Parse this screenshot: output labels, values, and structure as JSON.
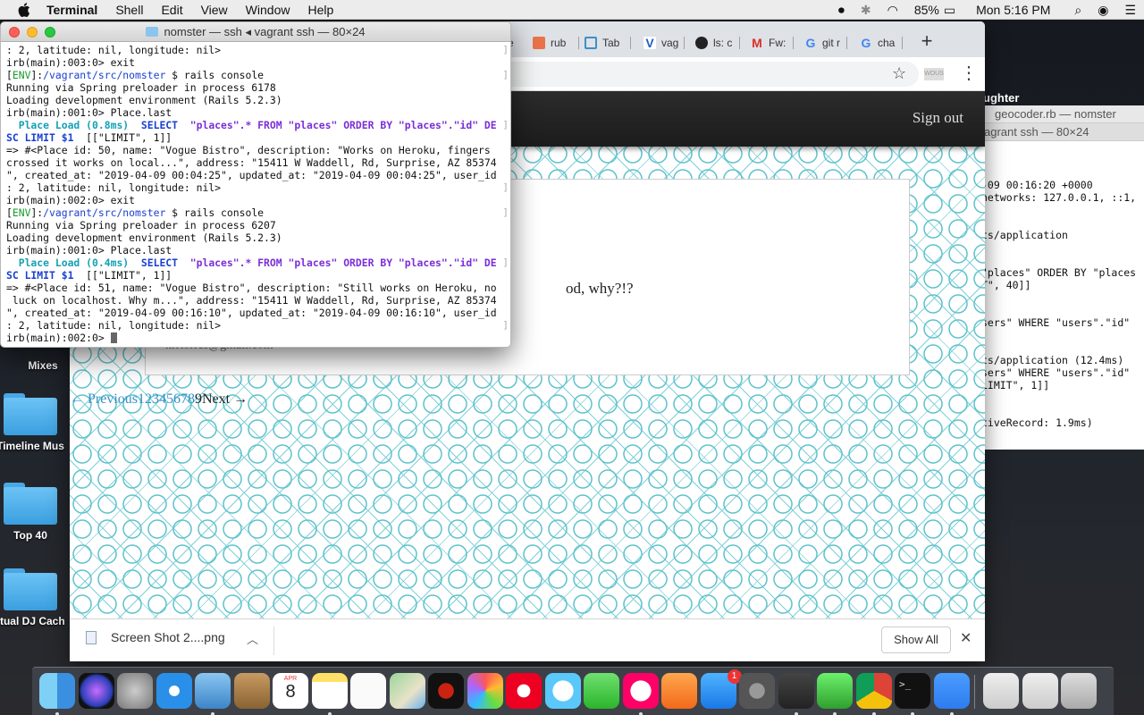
{
  "menubar": {
    "app": "Terminal",
    "items": [
      "Shell",
      "Edit",
      "View",
      "Window",
      "Help"
    ],
    "battery": "85%",
    "clock": "Mon 5:16 PM"
  },
  "desktop": {
    "folders": [
      "Mixes",
      "Timeline Mus",
      "Top 40",
      "rtual DJ Cach"
    ],
    "bg_window_title_1": "geocoder.rb — nomster",
    "bg_window_title_2": "agrant ssh — 80×24",
    "laughter": "ughter",
    "bg_lines": [
      "",
      "",
      "",
      "-09 00:16:20 +0000",
      "networks: 127.0.0.1, ::1,",
      "",
      "",
      "ts/application",
      "",
      "",
      "\"places\" ORDER BY \"places",
      "T\", 40]]",
      "",
      "",
      "sers\" WHERE \"users\".\"id\"",
      "",
      "",
      "ts/application (12.4ms)",
      "sers\" WHERE \"users\".\"id\"",
      "LIMIT\", 1]]",
      "",
      "",
      "tiveRecord: 1.9ms)"
    ]
  },
  "chrome": {
    "tabs": [
      "e",
      "rub",
      "Tab",
      "vag",
      "ls: c",
      "Fw:",
      "git r",
      "cha"
    ],
    "new_tab": "+",
    "ext_label": "WOUS",
    "page": {
      "sign_out": "Sign out",
      "card_text": "od, why?!?",
      "card_email": "nrrtorres@gmail.com",
      "pager": {
        "previous": "← Previous",
        "pages": [
          "1",
          "2",
          "3",
          "4",
          "5",
          "6",
          "7",
          "8"
        ],
        "current": "9",
        "next": "Next →"
      }
    },
    "download": {
      "file": "Screen Shot 2....png",
      "show_all": "Show All"
    }
  },
  "terminal": {
    "title": "nomster — ssh ◂ vagrant ssh — 80×24",
    "lines": [
      ": 2, latitude: nil, longitude: nil>",
      "irb(main):003:0> exit",
      "[ENV]:/vagrant/src/nomster $ rails console",
      "Running via Spring preloader in process 6178",
      "Loading development environment (Rails 5.2.3)",
      "irb(main):001:0> Place.last",
      "  Place Load (0.8ms)  SELECT  \"places\".* FROM \"places\" ORDER BY \"places\".\"id\" DE",
      "SC LIMIT $1  [[\"LIMIT\", 1]]",
      "=> #<Place id: 50, name: \"Vogue Bistro\", description: \"Works on Heroku, fingers",
      "crossed it works on local...\", address: \"15411 W Waddell, Rd, Surprise, AZ 85374",
      "\", created_at: \"2019-04-09 00:04:25\", updated_at: \"2019-04-09 00:04:25\", user_id",
      ": 2, latitude: nil, longitude: nil>",
      "irb(main):002:0> exit",
      "[ENV]:/vagrant/src/nomster $ rails console",
      "Running via Spring preloader in process 6207",
      "Loading development environment (Rails 5.2.3)",
      "irb(main):001:0> Place.last",
      "  Place Load (0.4ms)  SELECT  \"places\".* FROM \"places\" ORDER BY \"places\".\"id\" DE",
      "SC LIMIT $1  [[\"LIMIT\", 1]]",
      "=> #<Place id: 51, name: \"Vogue Bistro\", description: \"Still works on Heroku, no",
      " luck on localhost. Why m...\", address: \"15411 W Waddell, Rd, Surprise, AZ 85374",
      "\", created_at: \"2019-04-09 00:16:10\", updated_at: \"2019-04-09 00:16:10\", user_id",
      ": 2, latitude: nil, longitude: nil>",
      "irb(main):002:0> "
    ]
  },
  "dock": {
    "apps": [
      "finder-icon",
      "siri-icon",
      "launchpad-icon",
      "safari-icon",
      "mail-icon",
      "contacts-icon",
      "calendar-icon",
      "notes-icon",
      "reminders-icon",
      "maps-icon",
      "virtualdj-icon",
      "photos-icon",
      "record-icon",
      "messages-icon",
      "facetime-icon",
      "itunes-icon",
      "ibooks-icon",
      "app-store-icon",
      "system-preferences-icon",
      "sublime-text-icon",
      "instrument-icon",
      "chrome-icon",
      "terminal-icon",
      "zoom-icon",
      "documents-icon",
      "downloads-icon",
      "trash-icon"
    ],
    "calendar_month": "APR",
    "calendar_day": "8",
    "app_store_badge": "1"
  },
  "colors": {
    "accent_link": "#3b8fc4",
    "pattern": "#5cc2cc",
    "nav_dark": "#1c1c1c",
    "term_green": "#1a9a2a",
    "term_blue": "#1b3fd1"
  }
}
